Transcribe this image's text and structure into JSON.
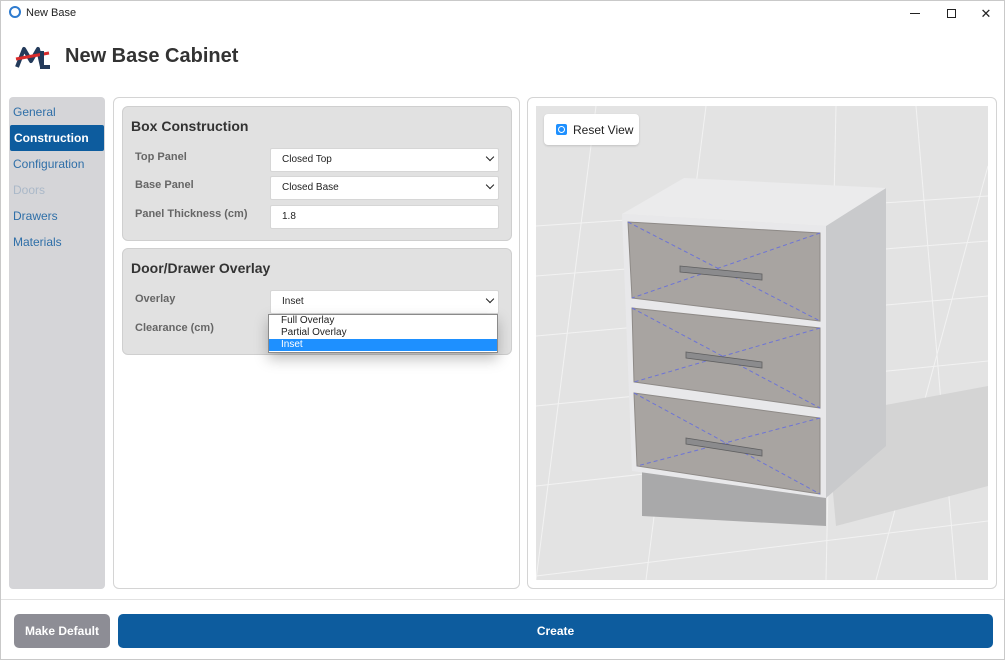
{
  "window": {
    "title": "New Base"
  },
  "header": {
    "title": "New Base Cabinet"
  },
  "sidebar": {
    "items": [
      {
        "label": "General",
        "state": "normal"
      },
      {
        "label": "Construction",
        "state": "active"
      },
      {
        "label": "Configuration",
        "state": "normal"
      },
      {
        "label": "Doors",
        "state": "disabled"
      },
      {
        "label": "Drawers",
        "state": "normal"
      },
      {
        "label": "Materials",
        "state": "normal"
      }
    ]
  },
  "box_construction": {
    "title": "Box Construction",
    "top_panel": {
      "label": "Top Panel",
      "value": "Closed Top"
    },
    "base_panel": {
      "label": "Base Panel",
      "value": "Closed Base"
    },
    "panel_thickness": {
      "label": "Panel Thickness (cm)",
      "value": "1.8"
    }
  },
  "overlay_group": {
    "title": "Door/Drawer Overlay",
    "overlay": {
      "label": "Overlay",
      "value": "Inset"
    },
    "clearance": {
      "label": "Clearance (cm)"
    },
    "dropdown_options": [
      "Full Overlay",
      "Partial Overlay",
      "Inset"
    ]
  },
  "viewport": {
    "reset_label": "Reset View"
  },
  "footer": {
    "make_default_label": "Make Default",
    "create_label": "Create"
  },
  "colors": {
    "accent": "#0d5c9e",
    "selection": "#1e90ff",
    "sidebar_bg": "#d5d5d8",
    "group_bg": "#e1e1e1"
  },
  "icons": [
    "app-icon",
    "logo",
    "chevron-down-icon",
    "reset-view-icon",
    "minimize-icon",
    "maximize-icon",
    "close-icon"
  ]
}
